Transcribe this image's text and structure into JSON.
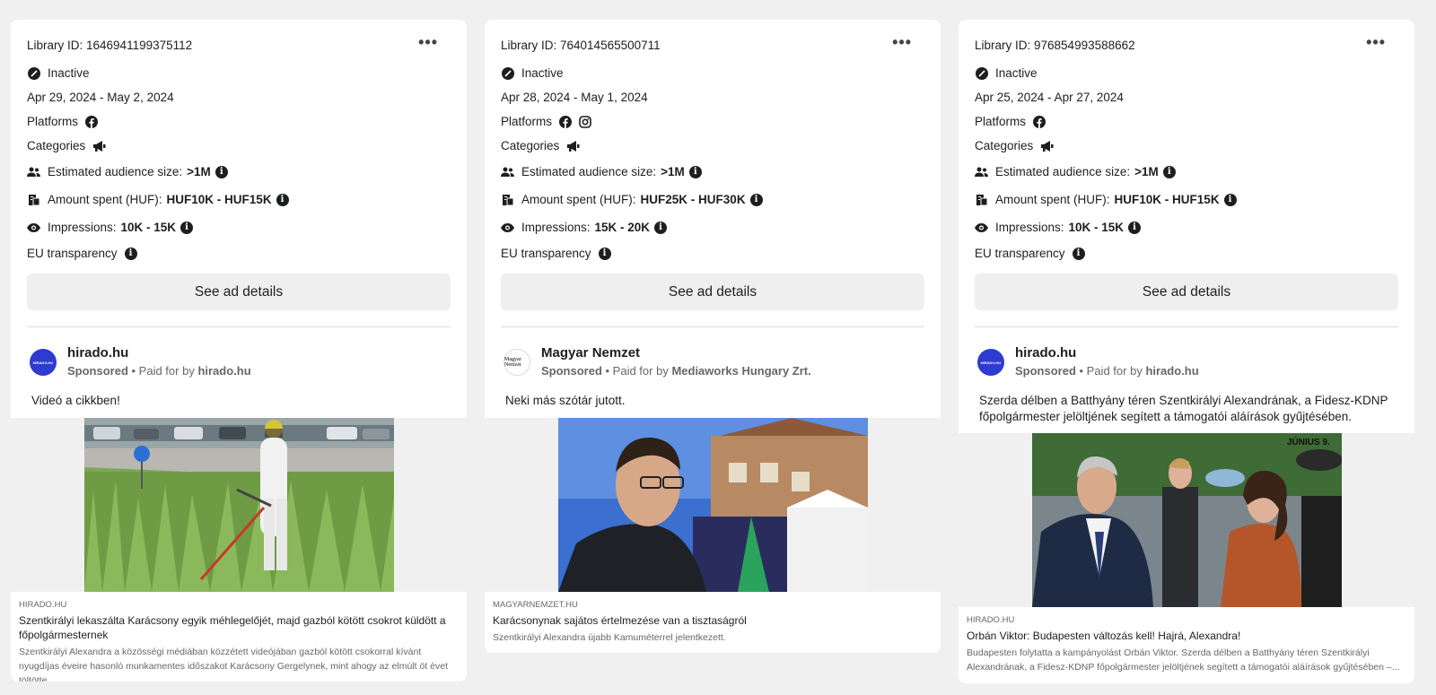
{
  "cards": [
    {
      "library_id": "Library ID: 1646941199375112",
      "status": "Inactive",
      "dates": "Apr 29, 2024 - May 2, 2024",
      "platforms_label": "Platforms",
      "platforms": [
        "facebook-icon"
      ],
      "categories_label": "Categories",
      "audience_label": "Estimated audience size:",
      "audience_value": ">1M",
      "amount_label": "Amount spent (HUF):",
      "amount_value": "HUF10K - HUF15K",
      "impressions_label": "Impressions:",
      "impressions_value": "10K - 15K",
      "eu_label": "EU transparency",
      "button": "See ad details",
      "advertiser": "hirado.hu",
      "sponsored": "Sponsored",
      "paid_for_prefix": " • Paid for by ",
      "paid_for": "hirado.hu",
      "avatar_text": "HIRADO.HU",
      "body": "Videó a cikkben!",
      "link_domain": "HIRADO.HU",
      "link_title": "Szentkirályi lekaszálta Karácsony egyik méhlegelőjét, majd gazból kötött csokrot küldött a főpolgármesternek",
      "link_desc": "Szentkirályi Alexandra a közösségi médiában közzétett videójában gazból kötött csokorral kívánt nyugdíjas éveire hasonló munkamentes időszakot Karácsony Gergelynek, mint ahogy az elmúlt öt évet töltötte."
    },
    {
      "library_id": "Library ID: 764014565500711",
      "status": "Inactive",
      "dates": "Apr 28, 2024 - May 1, 2024",
      "platforms_label": "Platforms",
      "platforms": [
        "facebook-icon",
        "instagram-icon"
      ],
      "categories_label": "Categories",
      "audience_label": "Estimated audience size:",
      "audience_value": ">1M",
      "amount_label": "Amount spent (HUF):",
      "amount_value": "HUF25K - HUF30K",
      "impressions_label": "Impressions:",
      "impressions_value": "15K - 20K",
      "eu_label": "EU transparency",
      "button": "See ad details",
      "advertiser": "Magyar Nemzet",
      "sponsored": "Sponsored",
      "paid_for_prefix": " • Paid for by ",
      "paid_for": "Mediaworks Hungary Zrt.",
      "avatar_text": "Magyar Nemzet",
      "body": "Neki más szótár jutott.",
      "link_domain": "MAGYARNEMZET.HU",
      "link_title": "Karácsonynak sajátos értelmezése van a tisztaságról",
      "link_desc": "Szentkirályi Alexandra újabb Kamuméterrel jelentkezett."
    },
    {
      "library_id": "Library ID: 976854993588662",
      "status": "Inactive",
      "dates": "Apr 25, 2024 - Apr 27, 2024",
      "platforms_label": "Platforms",
      "platforms": [
        "facebook-icon"
      ],
      "categories_label": "Categories",
      "audience_label": "Estimated audience size:",
      "audience_value": ">1M",
      "amount_label": "Amount spent (HUF):",
      "amount_value": "HUF10K - HUF15K",
      "impressions_label": "Impressions:",
      "impressions_value": "10K - 15K",
      "eu_label": "EU transparency",
      "button": "See ad details",
      "advertiser": "hirado.hu",
      "sponsored": "Sponsored",
      "paid_for_prefix": " • Paid for by ",
      "paid_for": "hirado.hu",
      "avatar_text": "HIRADO.HU",
      "body": "Szerda délben a Batthyány téren Szentkirályi Alexandrának, a Fidesz-KDNP főpolgármester jelöltjének segített a támogatói aláírások gyűjtésében.",
      "image_overlay": "JÚNIUS 9.",
      "link_domain": "HIRADO.HU",
      "link_title": "Orbán Viktor: Budapesten változás kell! Hajrá, Alexandra!",
      "link_desc": "Budapesten folytatta a kampányolást Orbán Viktor. Szerda délben a Batthyány téren Szentkirályi Alexandrának, a Fidesz-KDNP főpolgármester jelöltjének segített a támogatói aláírások gyűjtésében –..."
    }
  ]
}
